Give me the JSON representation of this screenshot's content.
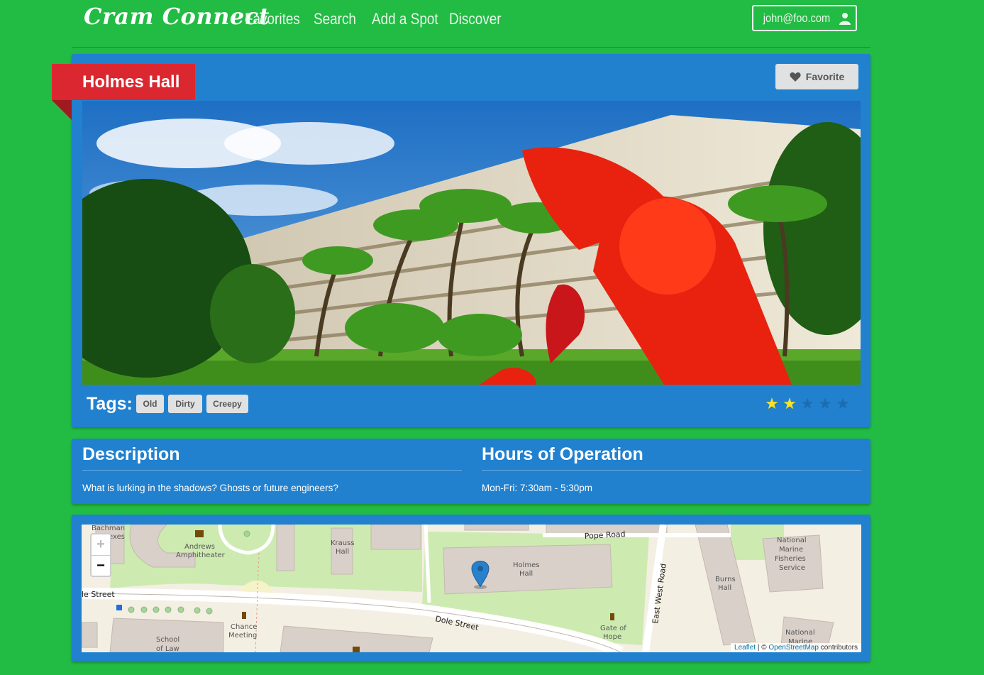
{
  "nav": {
    "brand": "Cram Connect",
    "links": [
      "Favorites",
      "Search",
      "Add a Spot",
      "Discover"
    ],
    "user_email": "john@foo.com"
  },
  "spot": {
    "name": "Holmes Hall",
    "favorite_label": "Favorite",
    "tags_label": "Tags:",
    "tags": [
      "Old",
      "Dirty",
      "Creepy"
    ],
    "rating": 2,
    "rating_max": 5
  },
  "info": {
    "description_title": "Description",
    "description": "What is lurking in the shadows? Ghosts or future engineers?",
    "hours_title": "Hours of Operation",
    "hours": "Mon-Fri: 7:30am - 5:30pm"
  },
  "map": {
    "zoom_in": "+",
    "zoom_out": "−",
    "attribution_leaflet": "Leaflet",
    "attribution_sep": " | © ",
    "attribution_osm": "OpenStreetMap",
    "attribution_suffix": " contributors",
    "labels": {
      "bachman": "Bachman",
      "annexes": "exes",
      "andrews1": "Andrews",
      "andrews2": "Amphitheater",
      "krauss1": "Krauss",
      "krauss2": "Hall",
      "holmes1": "Holmes",
      "holmes2": "Hall",
      "burns1": "Burns",
      "burns2": "Hall",
      "nmfs1": "National",
      "nmfs2": "Marine",
      "nmfs3": "Fisheries",
      "nmfs4": "Service",
      "nm_bottom1": "National",
      "nm_bottom2": "Marine",
      "pope_road": "Pope Road",
      "east_west_road": "East West Road",
      "dole_street": "Dole Street",
      "dole_street_left": "le Street",
      "chance1": "Chance",
      "chance2": "Meeting",
      "gate1": "Gate of",
      "gate2": "Hope",
      "law1": "School",
      "law2": "of Law"
    }
  },
  "colors": {
    "page_bg": "#22bb44",
    "card_bg": "#2181cf",
    "ribbon": "#db2830",
    "star_on": "#ffe21f",
    "star_off": "#1b6db0"
  }
}
